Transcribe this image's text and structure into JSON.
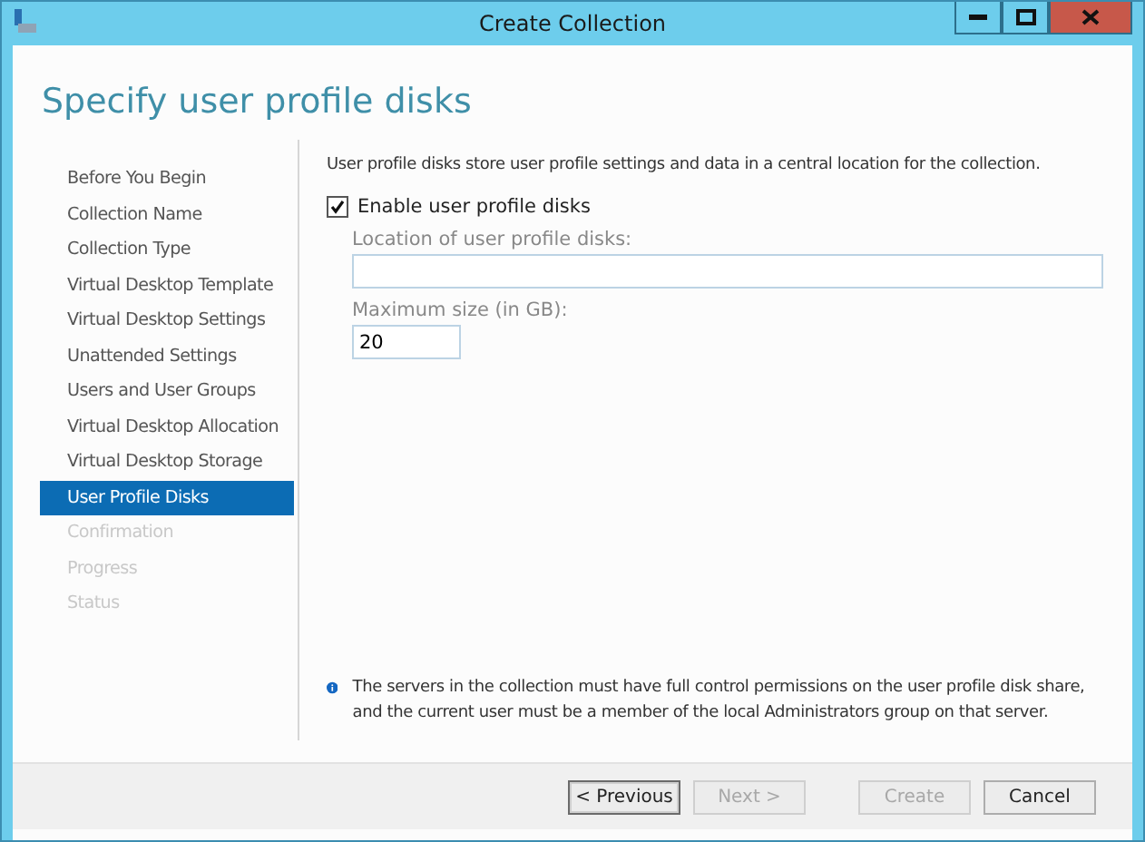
{
  "window": {
    "title": "Create Collection"
  },
  "heading": "Specify user profile disks",
  "steps": [
    {
      "label": "Before You Begin",
      "selected": false,
      "disabled": false
    },
    {
      "label": "Collection Name",
      "selected": false,
      "disabled": false
    },
    {
      "label": "Collection Type",
      "selected": false,
      "disabled": false
    },
    {
      "label": "Virtual Desktop Template",
      "selected": false,
      "disabled": false
    },
    {
      "label": "Virtual Desktop Settings",
      "selected": false,
      "disabled": false
    },
    {
      "label": "Unattended Settings",
      "selected": false,
      "disabled": false
    },
    {
      "label": "Users and User Groups",
      "selected": false,
      "disabled": false
    },
    {
      "label": "Virtual Desktop Allocation",
      "selected": false,
      "disabled": false
    },
    {
      "label": "Virtual Desktop Storage",
      "selected": false,
      "disabled": false
    },
    {
      "label": "User Profile Disks",
      "selected": true,
      "disabled": false
    },
    {
      "label": "Confirmation",
      "selected": false,
      "disabled": true
    },
    {
      "label": "Progress",
      "selected": false,
      "disabled": true
    },
    {
      "label": "Status",
      "selected": false,
      "disabled": true
    }
  ],
  "description": "User profile disks store user profile settings and data in a central location for the collection.",
  "enable_checkbox": {
    "label": "Enable user profile disks",
    "checked": true
  },
  "location_field": {
    "label": "Location of user profile disks:"
  },
  "size_field": {
    "label": "Maximum size (in GB):",
    "value": "20"
  },
  "info_note": "The servers in the collection must have full control permissions on the user profile disk share, and the current user must be a member of the local Administrators group on that server.",
  "buttons": [
    {
      "label": "< Previous",
      "disabled": false,
      "default": true
    },
    {
      "label": "Next >",
      "disabled": true,
      "default": false
    },
    {
      "label": "Create",
      "disabled": true,
      "default": false
    },
    {
      "label": "Cancel",
      "disabled": false,
      "default": false
    }
  ]
}
